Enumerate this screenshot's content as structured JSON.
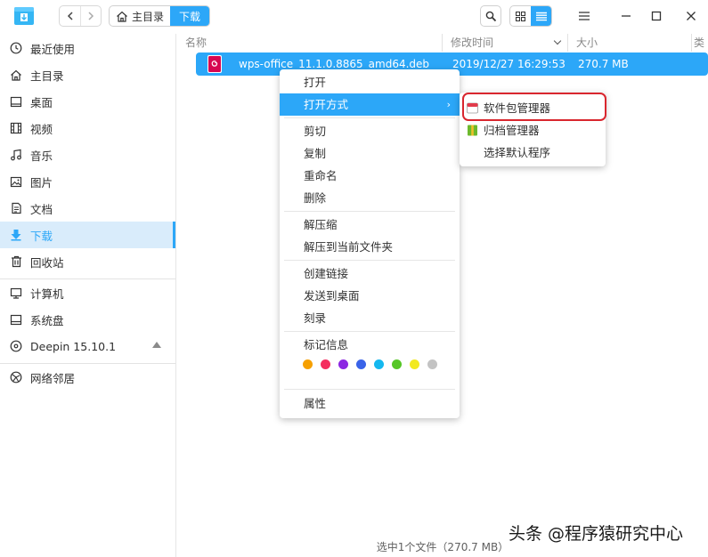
{
  "titlebar": {
    "breadcrumb_home": "主目录",
    "breadcrumb_current": "下载"
  },
  "sidebar": {
    "items": [
      {
        "label": "最近使用",
        "icon": "clock-icon"
      },
      {
        "label": "主目录",
        "icon": "home-icon"
      },
      {
        "label": "桌面",
        "icon": "desktop-icon"
      },
      {
        "label": "视频",
        "icon": "video-icon"
      },
      {
        "label": "音乐",
        "icon": "music-icon"
      },
      {
        "label": "图片",
        "icon": "picture-icon"
      },
      {
        "label": "文档",
        "icon": "document-icon"
      },
      {
        "label": "下载",
        "icon": "download-icon"
      },
      {
        "label": "回收站",
        "icon": "trash-icon"
      },
      {
        "label": "计算机",
        "icon": "computer-icon"
      },
      {
        "label": "系统盘",
        "icon": "disk-icon"
      },
      {
        "label": "Deepin 15.10.1",
        "icon": "disc-icon"
      },
      {
        "label": "网络邻居",
        "icon": "network-icon"
      }
    ]
  },
  "columns": {
    "name": "名称",
    "modified": "修改时间",
    "size": "大小",
    "type": "类"
  },
  "file": {
    "name": "wps-office_11.1.0.8865_amd64.deb",
    "modified": "2019/12/27 16:29:53",
    "size": "270.7 MB"
  },
  "context_menu": {
    "open": "打开",
    "open_with": "打开方式",
    "cut": "剪切",
    "copy": "复制",
    "rename": "重命名",
    "delete": "删除",
    "extract": "解压缩",
    "extract_here": "解压到当前文件夹",
    "create_link": "创建链接",
    "send_to_desktop": "发送到桌面",
    "burn": "刻录",
    "tag_info": "标记信息",
    "properties": "属性",
    "tag_colors": [
      "#f6a000",
      "#f42d5e",
      "#8c27e2",
      "#3a63e8",
      "#15b8ef",
      "#56c626",
      "#f2e920",
      "#c3c3c3"
    ]
  },
  "submenu": {
    "package_manager": "软件包管理器",
    "archive_manager": "归档管理器",
    "choose_default": "选择默认程序"
  },
  "status_bar": "选中1个文件（270.7 MB）",
  "watermark": "头条 @程序猿研究中心",
  "colors": {
    "accent": "#2ca7f8",
    "highlight_border": "#d9262e"
  }
}
